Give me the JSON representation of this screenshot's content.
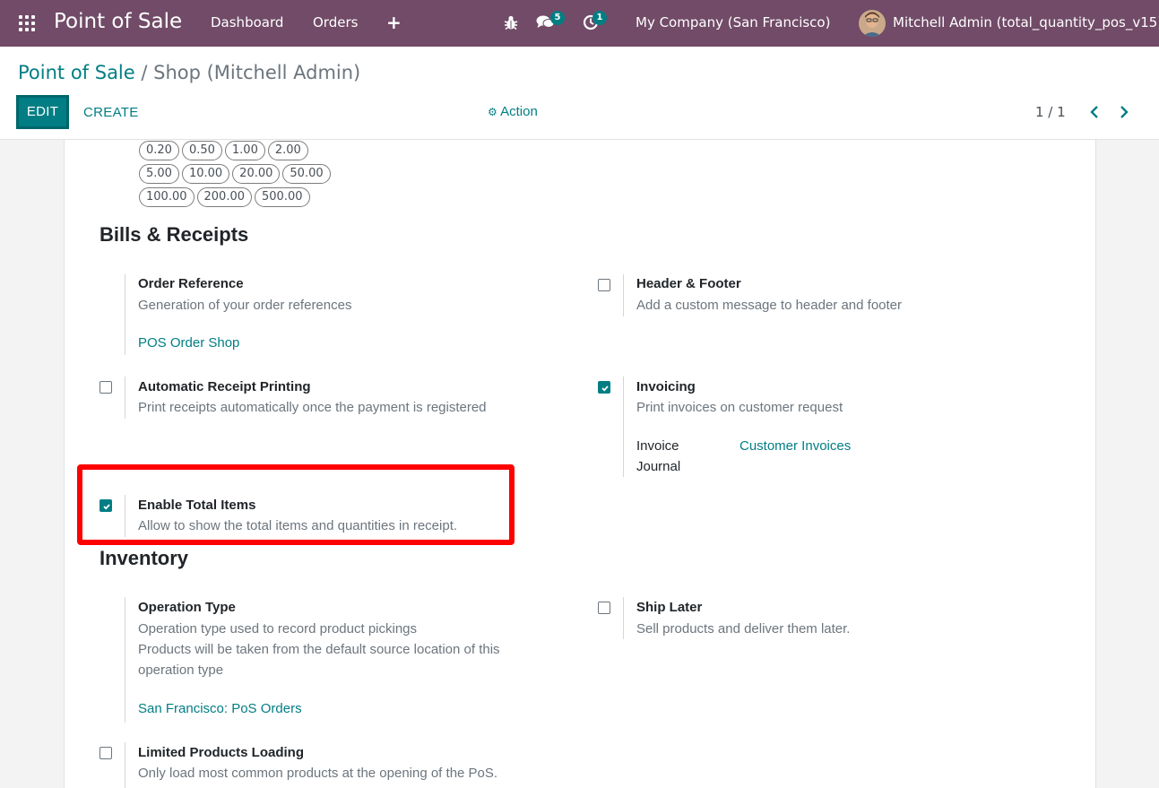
{
  "navbar": {
    "brand": "Point of Sale",
    "menu": [
      "Dashboard",
      "Orders"
    ],
    "plus_label": "+",
    "messages_count": "5",
    "activities_count": "1",
    "company": "My Company (San Francisco)",
    "user": "Mitchell Admin (total_quantity_pos_v15)",
    "bg_color": "#714b67"
  },
  "control_panel": {
    "breadcrumb_parent": "Point of Sale",
    "breadcrumb_sep": " / ",
    "breadcrumb_current": "Shop (Mitchell Admin)",
    "edit_label": "EDIT",
    "create_label": "CREATE",
    "action_label": "Action",
    "pager": "1 / 1"
  },
  "coins": {
    "row1": [
      "0.20",
      "0.50",
      "1.00",
      "2.00"
    ],
    "row2": [
      "5.00",
      "10.00",
      "20.00",
      "50.00"
    ],
    "row3": [
      "100.00",
      "200.00",
      "500.00"
    ]
  },
  "bills": {
    "section_title": "Bills & Receipts",
    "order_reference": {
      "title": "Order Reference",
      "desc": "Generation of your order references",
      "link": "POS Order Shop"
    },
    "header_footer": {
      "title": "Header & Footer",
      "desc": "Add a custom message to header and footer",
      "checked": false
    },
    "auto_receipt": {
      "title": "Automatic Receipt Printing",
      "desc": "Print receipts automatically once the payment is registered",
      "checked": false
    },
    "invoicing": {
      "title": "Invoicing",
      "desc": "Print invoices on customer request",
      "checked": true,
      "journal_label_1": "Invoice",
      "journal_label_2": "Journal",
      "journal_value": "Customer Invoices"
    },
    "total_items": {
      "title": "Enable Total Items",
      "desc": "Allow to show the total items and quantities in receipt.",
      "checked": true
    }
  },
  "inventory": {
    "section_title": "Inventory",
    "operation_type": {
      "title": "Operation Type",
      "desc1": "Operation type used to record product pickings",
      "desc2": "Products will be taken from the default source location of this",
      "desc3": "operation type",
      "link": "San Francisco: PoS Orders"
    },
    "ship_later": {
      "title": "Ship Later",
      "desc": "Sell products and deliver them later.",
      "checked": false
    },
    "limited_loading": {
      "title": "Limited Products Loading",
      "desc": "Only load most common products at the opening of the PoS.",
      "checked": false
    }
  },
  "colors": {
    "primary": "#017e84",
    "highlight": "#ff0000"
  }
}
